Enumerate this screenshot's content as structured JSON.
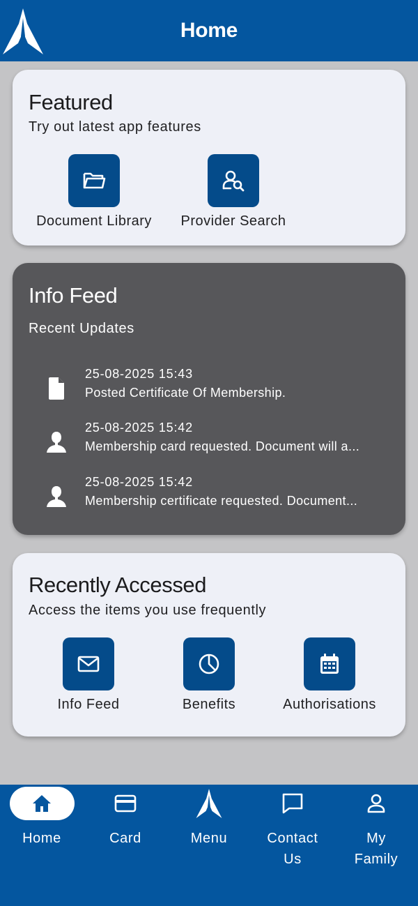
{
  "header": {
    "title": "Home"
  },
  "featured": {
    "title": "Featured",
    "subtitle": "Try out latest app features",
    "items": [
      {
        "label": "Document Library",
        "icon": "folder-icon"
      },
      {
        "label": "Provider Search",
        "icon": "provider-search-icon"
      }
    ]
  },
  "info_feed": {
    "title": "Info Feed",
    "subtitle": "Recent Updates",
    "items": [
      {
        "time": "25-08-2025 15:43",
        "text": "Posted Certificate Of Membership.",
        "icon": "document-icon"
      },
      {
        "time": "25-08-2025 15:42",
        "text": "Membership card requested. Document will a...",
        "icon": "person-icon"
      },
      {
        "time": "25-08-2025 15:42",
        "text": "Membership certificate requested. Document...",
        "icon": "person-icon"
      }
    ]
  },
  "recently_accessed": {
    "title": "Recently Accessed",
    "subtitle": "Access the items you use frequently",
    "items": [
      {
        "label": "Info Feed",
        "icon": "mail-icon"
      },
      {
        "label": "Benefits",
        "icon": "pie-chart-icon"
      },
      {
        "label": "Authorisations",
        "icon": "calendar-icon"
      }
    ]
  },
  "tabbar": {
    "home": "Home",
    "card": "Card",
    "menu": "Menu",
    "contact_line1": "Contact",
    "contact_line2": "Us",
    "family_line1": "My",
    "family_line2": "Family"
  },
  "colors": {
    "brand": "#04569f",
    "tile": "#044b8a",
    "background": "#c4c4c6",
    "card": "#eef0f7",
    "dark_card": "#57575a"
  }
}
